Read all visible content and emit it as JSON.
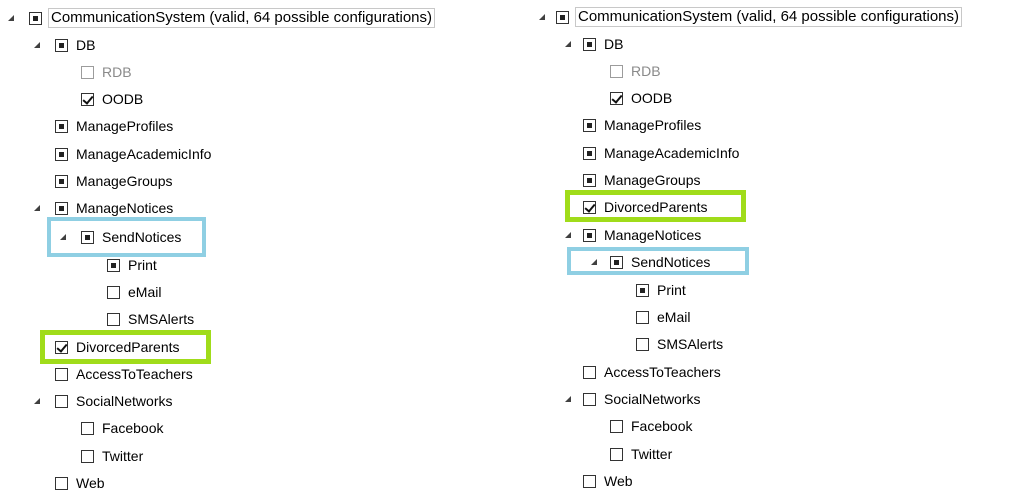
{
  "left_tree": {
    "root": {
      "label": "CommunicationSystem (valid, 64 possible configurations)",
      "state": "indeterminate"
    },
    "db": {
      "label": "DB",
      "state": "indeterminate"
    },
    "rdb": {
      "label": "RDB",
      "state": "disabled"
    },
    "oodb": {
      "label": "OODB",
      "state": "checked"
    },
    "manage_profiles": {
      "label": "ManageProfiles",
      "state": "indeterminate"
    },
    "manage_academic_info": {
      "label": "ManageAcademicInfo",
      "state": "indeterminate"
    },
    "manage_groups": {
      "label": "ManageGroups",
      "state": "indeterminate"
    },
    "manage_notices": {
      "label": "ManageNotices",
      "state": "indeterminate"
    },
    "send_notices": {
      "label": "SendNotices",
      "state": "indeterminate",
      "highlight": "blue"
    },
    "print": {
      "label": "Print",
      "state": "indeterminate"
    },
    "email": {
      "label": "eMail",
      "state": "unchecked"
    },
    "sms_alerts": {
      "label": "SMSAlerts",
      "state": "unchecked"
    },
    "divorced_parents": {
      "label": "DivorcedParents",
      "state": "checked",
      "highlight": "green"
    },
    "access_to_teachers": {
      "label": "AccessToTeachers",
      "state": "unchecked"
    },
    "social_networks": {
      "label": "SocialNetworks",
      "state": "unchecked"
    },
    "facebook": {
      "label": "Facebook",
      "state": "unchecked"
    },
    "twitter": {
      "label": "Twitter",
      "state": "unchecked"
    },
    "web": {
      "label": "Web",
      "state": "unchecked"
    }
  },
  "right_tree": {
    "root": {
      "label": "CommunicationSystem (valid, 64 possible configurations)",
      "state": "indeterminate"
    },
    "db": {
      "label": "DB",
      "state": "indeterminate"
    },
    "rdb": {
      "label": "RDB",
      "state": "disabled"
    },
    "oodb": {
      "label": "OODB",
      "state": "checked"
    },
    "manage_profiles": {
      "label": "ManageProfiles",
      "state": "indeterminate"
    },
    "manage_academic_info": {
      "label": "ManageAcademicInfo",
      "state": "indeterminate"
    },
    "manage_groups": {
      "label": "ManageGroups",
      "state": "indeterminate"
    },
    "divorced_parents": {
      "label": "DivorcedParents",
      "state": "checked",
      "highlight": "green"
    },
    "manage_notices": {
      "label": "ManageNotices",
      "state": "indeterminate"
    },
    "send_notices": {
      "label": "SendNotices",
      "state": "indeterminate",
      "highlight": "blue"
    },
    "print": {
      "label": "Print",
      "state": "indeterminate"
    },
    "email": {
      "label": "eMail",
      "state": "unchecked"
    },
    "sms_alerts": {
      "label": "SMSAlerts",
      "state": "unchecked"
    },
    "access_to_teachers": {
      "label": "AccessToTeachers",
      "state": "unchecked"
    },
    "social_networks": {
      "label": "SocialNetworks",
      "state": "unchecked"
    },
    "facebook": {
      "label": "Facebook",
      "state": "unchecked"
    },
    "twitter": {
      "label": "Twitter",
      "state": "unchecked"
    },
    "web": {
      "label": "Web",
      "state": "unchecked"
    }
  },
  "colors": {
    "highlight_green": "#a0dc1a",
    "highlight_blue": "#8fcfe3",
    "disabled_text": "#8a8a8a"
  }
}
